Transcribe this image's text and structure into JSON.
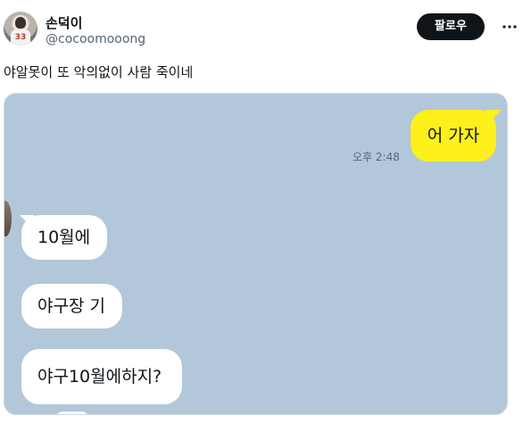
{
  "tweet": {
    "display_name": "손덕이",
    "handle": "@cocoomooong",
    "follow_label": "팔로우",
    "text": "야알못이 또 악의없이 사람 죽이네",
    "avatar_number": "33"
  },
  "chat": {
    "my_message": "어 가자",
    "my_time": "오후 2:48",
    "peer_messages": [
      "10월에",
      "야구장 기",
      "야구10월에하지?"
    ]
  },
  "colors": {
    "chat_background": "#b2c7d9",
    "my_bubble": "#fef01b",
    "peer_bubble": "#ffffff",
    "follow_button": "#0f1419"
  },
  "icons": [
    "more-icon"
  ]
}
